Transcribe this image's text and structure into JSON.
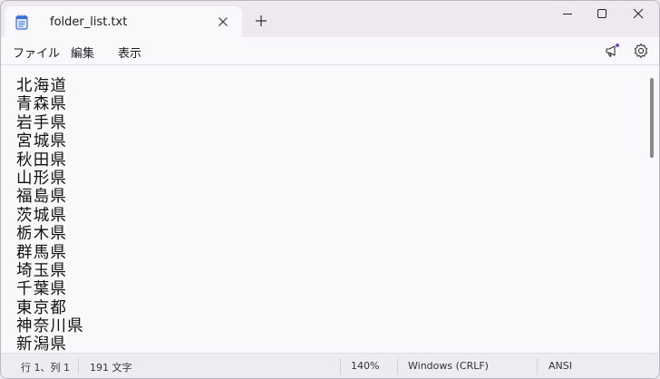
{
  "tab": {
    "title": "folder_list.txt"
  },
  "menu": {
    "file": "ファイル",
    "edit": "編集",
    "view": "表示"
  },
  "editor": {
    "lines": [
      "北海道",
      "青森県",
      "岩手県",
      "宮城県",
      "秋田県",
      "山形県",
      "福島県",
      "茨城県",
      "栃木県",
      "群馬県",
      "埼玉県",
      "千葉県",
      "東京都",
      "神奈川県",
      "新潟県"
    ]
  },
  "status": {
    "position": "行 1、列 1",
    "char_count": "191 文字",
    "zoom": "140%",
    "line_ending": "Windows (CRLF)",
    "encoding": "ANSI"
  },
  "icons": {
    "app": "notepad-icon",
    "tab_close": "close-icon",
    "new_tab": "plus-icon",
    "minimize": "minimize-icon",
    "maximize": "maximize-icon",
    "close": "close-icon",
    "announce": "megaphone-icon",
    "settings": "gear-icon"
  },
  "colors": {
    "accent": "#3b6fd3",
    "notification_dot": "#7b4bd1"
  }
}
